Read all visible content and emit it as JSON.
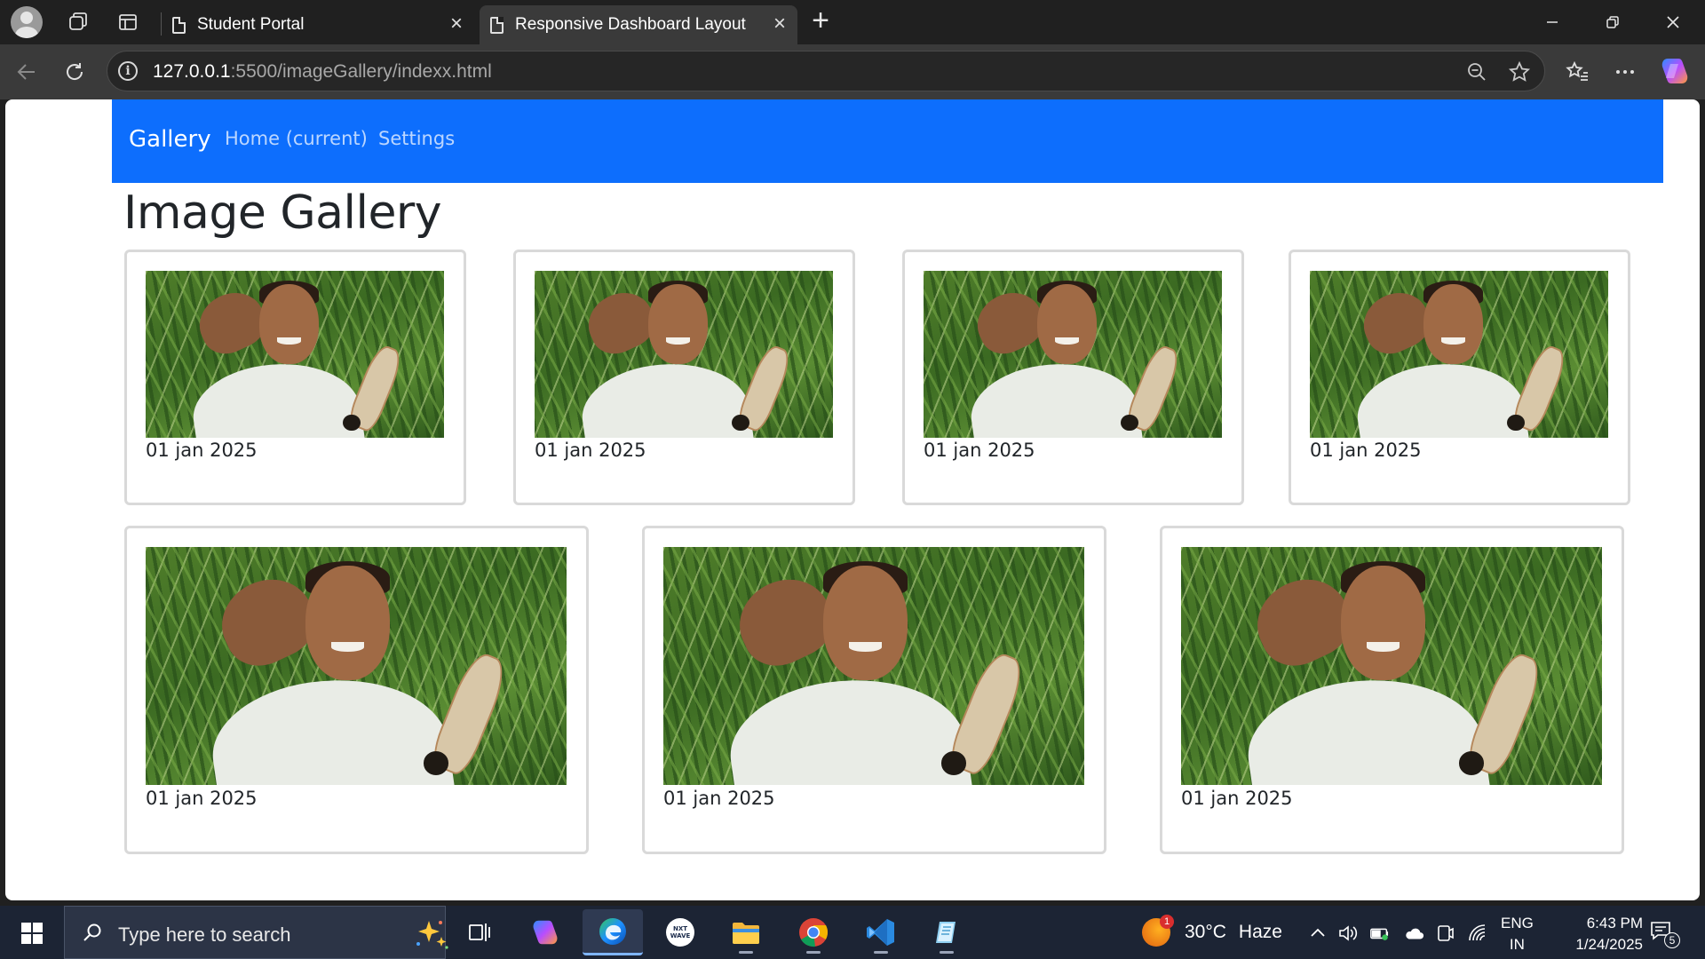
{
  "browser": {
    "tabs": [
      {
        "title": "Student Portal",
        "active": false
      },
      {
        "title": "Responsive Dashboard Layout",
        "active": true
      }
    ],
    "address": {
      "host": "127.0.0.1",
      "path": ":5500/imageGallery/indexx.html"
    }
  },
  "navbar": {
    "brand": "Gallery",
    "links": [
      "Home (current)",
      "Settings"
    ],
    "color": "#0d6efd"
  },
  "page": {
    "title": "Image Gallery",
    "cards_row1": [
      {
        "date": "01 jan 2025"
      },
      {
        "date": "01 jan 2025"
      },
      {
        "date": "01 jan 2025"
      },
      {
        "date": "01 jan 2025"
      }
    ],
    "cards_row2": [
      {
        "date": "01 jan 2025"
      },
      {
        "date": "01 jan 2025"
      },
      {
        "date": "01 jan 2025"
      }
    ]
  },
  "taskbar": {
    "search_placeholder": "Type here to search",
    "weather": {
      "temp": "30°C",
      "condition": "Haze",
      "badge": "1"
    },
    "language": {
      "line1": "ENG",
      "line2": "IN"
    },
    "clock": {
      "time": "6:43 PM",
      "date": "1/24/2025"
    },
    "notifications": "5",
    "apps": [
      "task-view",
      "copilot",
      "edge",
      "nxtwave",
      "file-explorer",
      "chrome",
      "vscode",
      "notepad"
    ]
  }
}
